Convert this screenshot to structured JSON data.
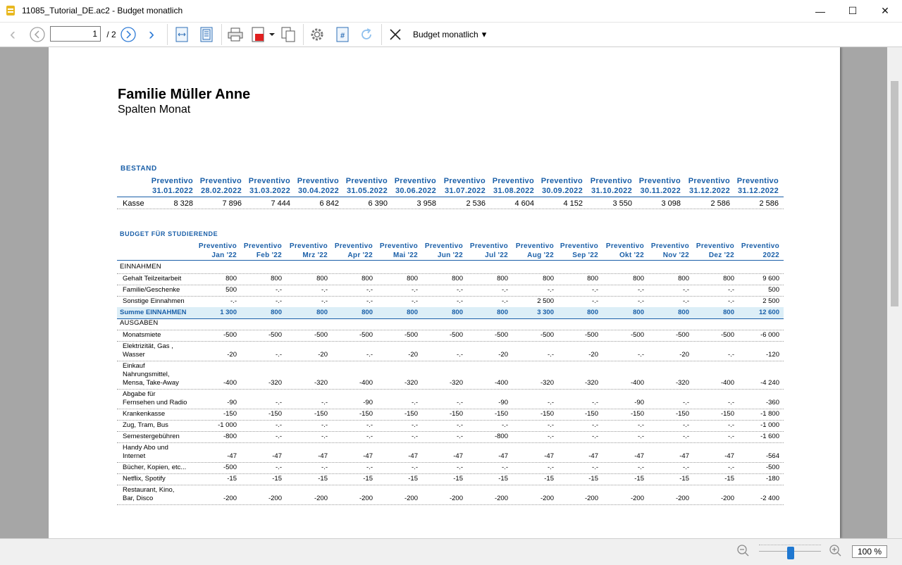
{
  "window": {
    "title": "11085_Tutorial_DE.ac2 - Budget monatlich",
    "minimize": "—",
    "maximize": "☐",
    "close": "✕"
  },
  "toolbar": {
    "back": "‹",
    "prev_page": "◁",
    "page_value": "1",
    "page_total": "/ 2",
    "next_page": "▷",
    "forward": "›",
    "report_name": "Budget monatlich",
    "dropdown": "▾"
  },
  "icons": {
    "fit_width": "fit-width-icon",
    "fit_page": "fit-page-icon",
    "print": "printer-icon",
    "pdf": "pdf-export-icon",
    "copy": "copy-icon",
    "settings": "gear-icon",
    "pagenum": "page-number-icon",
    "refresh": "refresh-icon",
    "close": "close-icon"
  },
  "status": {
    "zoom_out": "−",
    "zoom_in": "+",
    "zoom": "100 %",
    "zoom_level": 1.0
  },
  "report": {
    "title": "Familie Müller Anne",
    "subtitle": "Spalten Monat",
    "bestand": {
      "section": "BESTAND",
      "headers": [
        [
          "Preventivo",
          "31.01.2022"
        ],
        [
          "Preventivo",
          "28.02.2022"
        ],
        [
          "Preventivo",
          "31.03.2022"
        ],
        [
          "Preventivo",
          "30.04.2022"
        ],
        [
          "Preventivo",
          "31.05.2022"
        ],
        [
          "Preventivo",
          "30.06.2022"
        ],
        [
          "Preventivo",
          "31.07.2022"
        ],
        [
          "Preventivo",
          "31.08.2022"
        ],
        [
          "Preventivo",
          "30.09.2022"
        ],
        [
          "Preventivo",
          "31.10.2022"
        ],
        [
          "Preventivo",
          "30.11.2022"
        ],
        [
          "Preventivo",
          "31.12.2022"
        ],
        [
          "Preventivo",
          "31.12.2022"
        ]
      ],
      "rows": [
        {
          "label": "Kasse",
          "values": [
            "8 328",
            "7 896",
            "7 444",
            "6 842",
            "6 390",
            "3 958",
            "2 536",
            "4 604",
            "4 152",
            "3 550",
            "3 098",
            "2 586",
            "2 586"
          ]
        }
      ]
    },
    "budget": {
      "section": "BUDGET FÜR STUDIERENDE",
      "headers": [
        [
          "Preventivo",
          "Jan '22"
        ],
        [
          "Preventivo",
          "Feb '22"
        ],
        [
          "Preventivo",
          "Mrz '22"
        ],
        [
          "Preventivo",
          "Apr '22"
        ],
        [
          "Preventivo",
          "Mai '22"
        ],
        [
          "Preventivo",
          "Jun '22"
        ],
        [
          "Preventivo",
          "Jul '22"
        ],
        [
          "Preventivo",
          "Aug '22"
        ],
        [
          "Preventivo",
          "Sep '22"
        ],
        [
          "Preventivo",
          "Okt '22"
        ],
        [
          "Preventivo",
          "Nov '22"
        ],
        [
          "Preventivo",
          "Dez '22"
        ],
        [
          "Preventivo",
          "2022"
        ]
      ],
      "rows": [
        {
          "type": "group",
          "label": "EINNAHMEN"
        },
        {
          "label": "Gehalt Teilzeitarbeit",
          "values": [
            "800",
            "800",
            "800",
            "800",
            "800",
            "800",
            "800",
            "800",
            "800",
            "800",
            "800",
            "800",
            "9 600"
          ]
        },
        {
          "label": "Familie/Geschenke",
          "values": [
            "500",
            "-.-",
            "-.-",
            "-.-",
            "-.-",
            "-.-",
            "-.-",
            "-.-",
            "-.-",
            "-.-",
            "-.-",
            "-.-",
            "500"
          ]
        },
        {
          "label": "Sonstige Einnahmen",
          "values": [
            "-.-",
            "-.-",
            "-.-",
            "-.-",
            "-.-",
            "-.-",
            "-.-",
            "2 500",
            "-.-",
            "-.-",
            "-.-",
            "-.-",
            "2 500"
          ]
        },
        {
          "type": "sum",
          "label": "Summe EINNAHMEN",
          "values": [
            "1 300",
            "800",
            "800",
            "800",
            "800",
            "800",
            "800",
            "3 300",
            "800",
            "800",
            "800",
            "800",
            "12 600"
          ]
        },
        {
          "type": "group",
          "label": "AUSGABEN"
        },
        {
          "label": "Monatsmiete",
          "values": [
            "-500",
            "-500",
            "-500",
            "-500",
            "-500",
            "-500",
            "-500",
            "-500",
            "-500",
            "-500",
            "-500",
            "-500",
            "-6 000"
          ]
        },
        {
          "label": "Elektrizität, Gas ,\nWasser",
          "values": [
            "-20",
            "-.-",
            "-20",
            "-.-",
            "-20",
            "-.-",
            "-20",
            "-.-",
            "-20",
            "-.-",
            "-20",
            "-.-",
            "-120"
          ]
        },
        {
          "label": "Einkauf\nNahrungsmittel,\nMensa, Take-Away",
          "values": [
            "-400",
            "-320",
            "-320",
            "-400",
            "-320",
            "-320",
            "-400",
            "-320",
            "-320",
            "-400",
            "-320",
            "-400",
            "-4 240"
          ]
        },
        {
          "label": "Abgabe für\nFernsehen und Radio",
          "values": [
            "-90",
            "-.-",
            "-.-",
            "-90",
            "-.-",
            "-.-",
            "-90",
            "-.-",
            "-.-",
            "-90",
            "-.-",
            "-.-",
            "-360"
          ]
        },
        {
          "label": "Krankenkasse",
          "values": [
            "-150",
            "-150",
            "-150",
            "-150",
            "-150",
            "-150",
            "-150",
            "-150",
            "-150",
            "-150",
            "-150",
            "-150",
            "-1 800"
          ]
        },
        {
          "label": "Zug, Tram, Bus",
          "values": [
            "-1 000",
            "-.-",
            "-.-",
            "-.-",
            "-.-",
            "-.-",
            "-.-",
            "-.-",
            "-.-",
            "-.-",
            "-.-",
            "-.-",
            "-1 000"
          ]
        },
        {
          "label": "Semestergebühren",
          "values": [
            "-800",
            "-.-",
            "-.-",
            "-.-",
            "-.-",
            "-.-",
            "-800",
            "-.-",
            "-.-",
            "-.-",
            "-.-",
            "-.-",
            "-1 600"
          ]
        },
        {
          "label": "Handy Abo und\nInternet",
          "values": [
            "-47",
            "-47",
            "-47",
            "-47",
            "-47",
            "-47",
            "-47",
            "-47",
            "-47",
            "-47",
            "-47",
            "-47",
            "-564"
          ]
        },
        {
          "label": "Bücher, Kopien, etc...",
          "values": [
            "-500",
            "-.-",
            "-.-",
            "-.-",
            "-.-",
            "-.-",
            "-.-",
            "-.-",
            "-.-",
            "-.-",
            "-.-",
            "-.-",
            "-500"
          ]
        },
        {
          "label": "Netflix, Spotify",
          "values": [
            "-15",
            "-15",
            "-15",
            "-15",
            "-15",
            "-15",
            "-15",
            "-15",
            "-15",
            "-15",
            "-15",
            "-15",
            "-180"
          ]
        },
        {
          "label": "Restaurant, Kino,\nBar, Disco",
          "values": [
            "-200",
            "-200",
            "-200",
            "-200",
            "-200",
            "-200",
            "-200",
            "-200",
            "-200",
            "-200",
            "-200",
            "-200",
            "-2 400"
          ]
        }
      ]
    }
  }
}
